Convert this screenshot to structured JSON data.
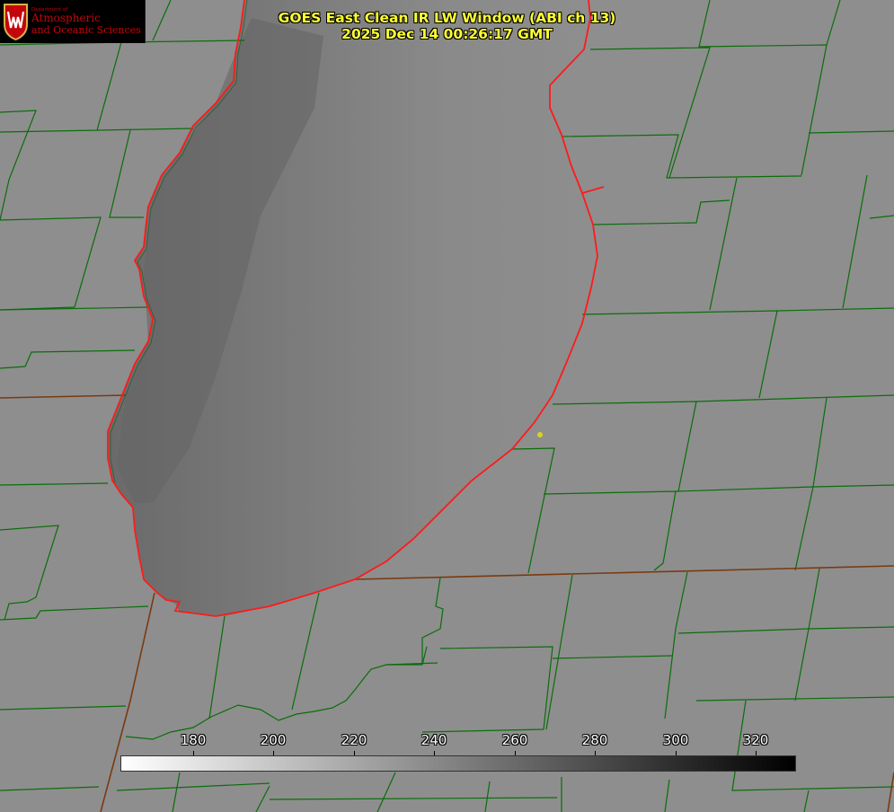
{
  "title": {
    "line1": "GOES East Clean IR LW Window (ABI ch 13)",
    "line2": "2025 Dec 14 00:26:17 GMT"
  },
  "logo": {
    "dept": "Department of",
    "name1": "Atmospheric",
    "name2": "and Oceanic Sciences",
    "crest_icon": "uw-crest-icon"
  },
  "colorbar": {
    "ticks": [
      {
        "label": "180",
        "value": 180
      },
      {
        "label": "200",
        "value": 200
      },
      {
        "label": "220",
        "value": 220
      },
      {
        "label": "240",
        "value": 240
      },
      {
        "label": "260",
        "value": 260
      },
      {
        "label": "280",
        "value": 280
      },
      {
        "label": "300",
        "value": 300
      },
      {
        "label": "320",
        "value": 320
      }
    ],
    "min_value": 162,
    "max_value": 330,
    "colors": {
      "low": "#ffffff",
      "high": "#000000"
    }
  },
  "colors": {
    "land": "#8e8e8e",
    "lake_cold": "#6f6f6f",
    "county_lines": "#0a6e0a",
    "shoreline": "#ff1a1a",
    "state_lines": "#7a3a10",
    "title_text": "#ffff33",
    "marker": "#e0d020"
  }
}
